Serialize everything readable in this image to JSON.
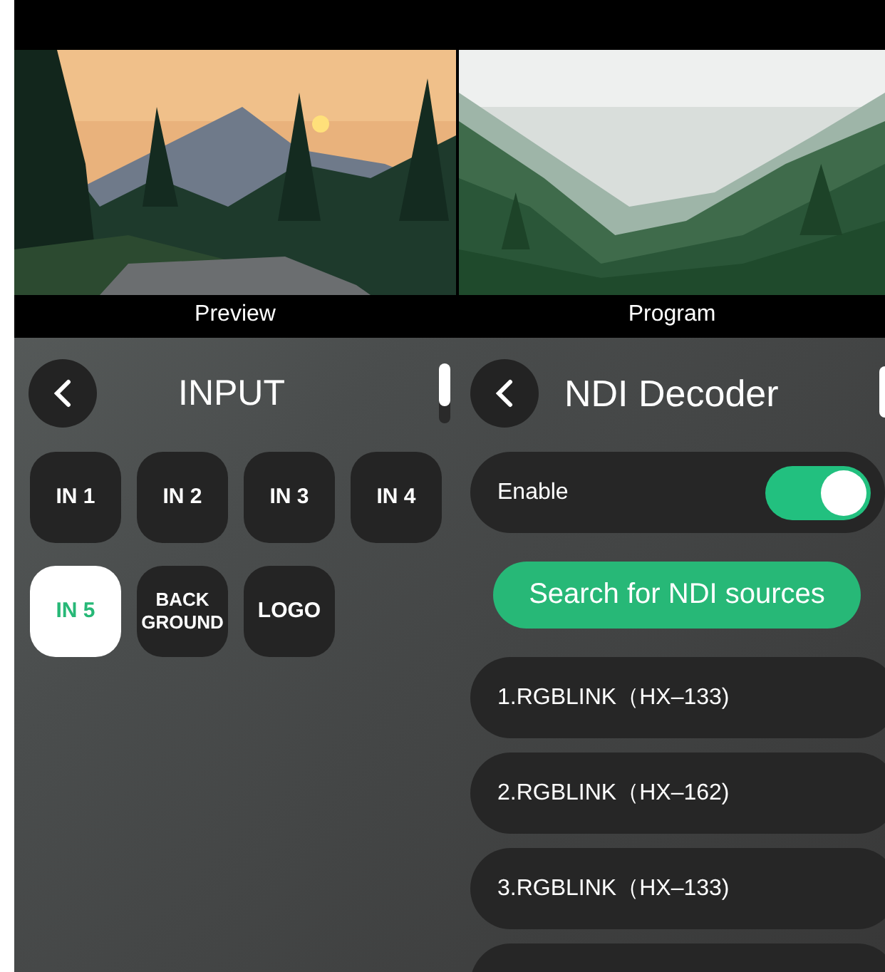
{
  "monitors": [
    {
      "kind": "preview",
      "label": "Preview"
    },
    {
      "kind": "program",
      "label": "Program"
    }
  ],
  "input_panel": {
    "title": "INPUT",
    "buttons": [
      {
        "label": "IN 1",
        "selected": false
      },
      {
        "label": "IN 2",
        "selected": false
      },
      {
        "label": "IN 3",
        "selected": false
      },
      {
        "label": "IN 4",
        "selected": false
      },
      {
        "label": "IN 5",
        "selected": true
      },
      {
        "label": "BACK GROUND",
        "selected": false
      },
      {
        "label": "LOGO",
        "selected": false
      }
    ]
  },
  "ndi_panel": {
    "title": "NDI Decoder",
    "enable": {
      "label": "Enable",
      "on": true
    },
    "search_button": "Search for NDI sources",
    "sources": [
      "1.RGBLINK（HX–133)",
      "2.RGBLINK（HX–162)",
      "3.RGBLINK（HX–133)"
    ]
  }
}
